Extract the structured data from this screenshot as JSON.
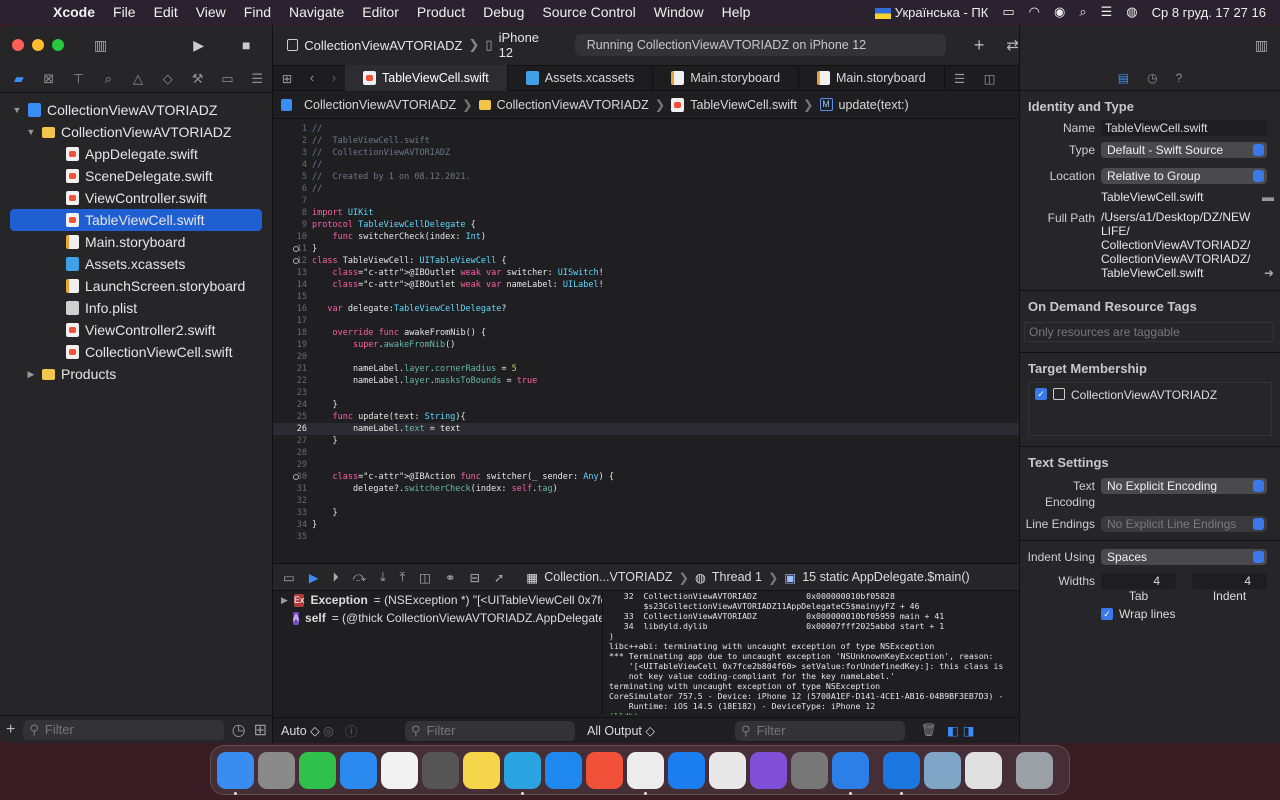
{
  "menubar": {
    "app": "Xcode",
    "items": [
      "File",
      "Edit",
      "View",
      "Find",
      "Navigate",
      "Editor",
      "Product",
      "Debug",
      "Source Control",
      "Window",
      "Help"
    ],
    "keyboard": "Українська - ПК",
    "clock": "Ср 8 груд.  17 27 16"
  },
  "toolbar": {
    "scheme": "CollectionViewAVTORIADZ",
    "device": "iPhone 12",
    "status": "Running CollectionViewAVTORIADZ on iPhone 12"
  },
  "navigator": {
    "project": "CollectionViewAVTORIADZ",
    "group": "CollectionViewAVTORIADZ",
    "files": [
      {
        "name": "AppDelegate.swift",
        "kind": "swift"
      },
      {
        "name": "SceneDelegate.swift",
        "kind": "swift"
      },
      {
        "name": "ViewController.swift",
        "kind": "swift"
      },
      {
        "name": "TableViewCell.swift",
        "kind": "swift",
        "selected": true
      },
      {
        "name": "Main.storyboard",
        "kind": "sb"
      },
      {
        "name": "Assets.xcassets",
        "kind": "asset"
      },
      {
        "name": "LaunchScreen.storyboard",
        "kind": "sb"
      },
      {
        "name": "Info.plist",
        "kind": "plist"
      },
      {
        "name": "ViewController2.swift",
        "kind": "swift"
      },
      {
        "name": "CollectionViewCell.swift",
        "kind": "swift"
      }
    ],
    "products": "Products",
    "filter_placeholder": "Filter"
  },
  "tabs": [
    {
      "label": "TableViewCell.swift",
      "active": true
    },
    {
      "label": "Assets.xcassets"
    },
    {
      "label": "Main.storyboard"
    },
    {
      "label": "Main.storyboard"
    }
  ],
  "jumpbar": [
    "CollectionViewAVTORIADZ",
    "CollectionViewAVTORIADZ",
    "TableViewCell.swift",
    "update(text:)"
  ],
  "current_line": 26,
  "breakpoint_lines": [
    11,
    12,
    30
  ],
  "code": [
    "//",
    "//  TableViewCell.swift",
    "//  CollectionViewAVTORIADZ",
    "//",
    "//  Created by 1 on 08.12.2021.",
    "//",
    "",
    "import UIKit",
    "protocol TableViewCellDelegate {",
    "    func switcherCheck(index: Int)",
    "}",
    "class TableViewCell: UITableViewCell {",
    "    @IBOutlet weak var switcher: UISwitch!",
    "    @IBOutlet weak var nameLabel: UILabel!",
    "",
    "   var delegate:TableViewCellDelegate?",
    "",
    "    override func awakeFromNib() {",
    "        super.awakeFromNib()",
    "",
    "        nameLabel.layer.cornerRadius = 5",
    "        nameLabel.layer.masksToBounds = true",
    "",
    "    }",
    "    func update(text: String){",
    "        nameLabel.text = text",
    "    }",
    "",
    "",
    "    @IBAction func switcher(_ sender: Any) {",
    "        delegate?.switcherCheck(index: self.tag)",
    "",
    "    }",
    "}",
    ""
  ],
  "debugbar": {
    "process": "Collection...VTORIADZ",
    "thread": "Thread 1",
    "frame": "15 static AppDelegate.$main()"
  },
  "variables": [
    {
      "badge": "Ex",
      "name": "Exception",
      "value": "= (NSException *) \"[<UITableViewCell 0x7fce..."
    },
    {
      "badge": "A",
      "name": "self",
      "value": "= (@thick CollectionViewAVTORIADZ.AppDelegate.Typ..."
    }
  ],
  "console": [
    "   32  CollectionViewAVTORIADZ          0x000000010bf05828",
    "       $s23CollectionViewAVTORIADZ11AppDelegateC5$mainyyFZ + 46",
    "   33  CollectionViewAVTORIADZ          0x000000010bf05959 main + 41",
    "   34  libdyld.dylib                    0x00007fff2025abbd start + 1",
    ")",
    "libc++abi: terminating with uncaught exception of type NSException",
    "*** Terminating app due to uncaught exception 'NSUnknownKeyException', reason:",
    "    '[<UITableViewCell 0x7fce2b804f60> setValue:forUndefinedKey:]: this class is",
    "    not key value coding-compliant for the key nameLabel.'",
    "terminating with uncaught exception of type NSException",
    "CoreSimulator 757.5 - Device: iPhone 12 (5700A1EF-D141-4CE1-AB16-04B9BF3EB7D3) -",
    "    Runtime: iOS 14.5 (18E182) - DeviceType: iPhone 12",
    "(lldb)"
  ],
  "debugfoot": {
    "auto": "Auto ◇",
    "filter": "Filter",
    "output": "All Output ◇",
    "filter2": "Filter"
  },
  "inspector": {
    "identity_title": "Identity and Type",
    "name_label": "Name",
    "name": "TableViewCell.swift",
    "type_label": "Type",
    "type": "Default - Swift Source",
    "location_label": "Location",
    "location": "Relative to Group",
    "location_file": "TableViewCell.swift",
    "fullpath_label": "Full Path",
    "fullpath": "/Users/a1/Desktop/DZ/NEW LIFE/ CollectionViewAVTORIADZ/ CollectionViewAVTORIADZ/ TableViewCell.swift",
    "odr_title": "On Demand Resource Tags",
    "odr_placeholder": "Only resources are taggable",
    "target_title": "Target Membership",
    "target": "CollectionViewAVTORIADZ",
    "text_title": "Text Settings",
    "enc_label": "Text Encoding",
    "enc": "No Explicit Encoding",
    "le_label": "Line Endings",
    "le": "No Explicit Line Endings",
    "indent_label": "Indent Using",
    "indent": "Spaces",
    "widths_label": "Widths",
    "tab_val": "4",
    "indent_val": "4",
    "tab_label": "Tab",
    "indent_lbl": "Indent",
    "wrap": "Wrap lines"
  },
  "colors": {
    "accent": "#3b8df6",
    "selection": "#1f5fd1"
  }
}
